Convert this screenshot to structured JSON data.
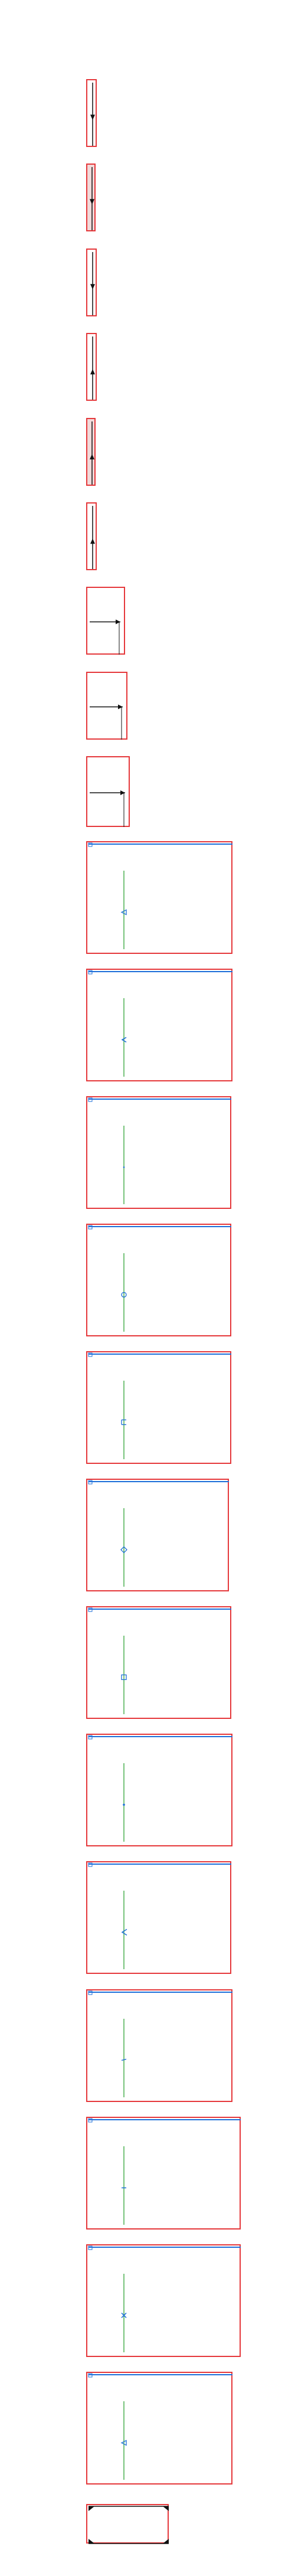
{
  "sheet": {
    "colors": {
      "frame": "#e5383b",
      "frame_fill_shaded": "#f1d9d9",
      "axis_line": "#4caf50",
      "marker": "#1e6fd9",
      "arrow": "#111111"
    },
    "cells": [
      {
        "id": "cell-1",
        "kind": "tall-arrow",
        "marker": "arrow-down-icon",
        "shaded": false
      },
      {
        "id": "cell-2",
        "kind": "tall-arrow",
        "marker": "arrow-down-icon",
        "shaded": true
      },
      {
        "id": "cell-3",
        "kind": "tall-arrow",
        "marker": "arrow-down-icon",
        "shaded": false
      },
      {
        "id": "cell-4",
        "kind": "tall-arrow",
        "marker": "arrow-up-icon",
        "shaded": false
      },
      {
        "id": "cell-5",
        "kind": "tall-arrow",
        "marker": "arrow-up-icon",
        "shaded": true
      },
      {
        "id": "cell-6",
        "kind": "tall-arrow",
        "marker": "arrow-up-icon",
        "shaded": false
      },
      {
        "id": "cell-7",
        "kind": "horizontal-arrow",
        "marker": "arrow-right-icon",
        "shaded": false
      },
      {
        "id": "cell-8",
        "kind": "horizontal-arrow",
        "marker": "arrow-right-icon",
        "shaded": false
      },
      {
        "id": "cell-9",
        "kind": "horizontal-arrow",
        "marker": "arrow-right-icon",
        "shaded": false
      },
      {
        "id": "cell-10",
        "kind": "marker-panel",
        "marker": "triangle-outline-icon"
      },
      {
        "id": "cell-11",
        "kind": "marker-panel",
        "marker": "caret-up-icon"
      },
      {
        "id": "cell-12",
        "kind": "marker-panel",
        "marker": "dot-icon"
      },
      {
        "id": "cell-13",
        "kind": "marker-panel",
        "marker": "circle-outline-icon"
      },
      {
        "id": "cell-14",
        "kind": "marker-panel",
        "marker": "bracket-icon"
      },
      {
        "id": "cell-15",
        "kind": "marker-panel",
        "marker": "diamond-outline-icon"
      },
      {
        "id": "cell-16",
        "kind": "marker-panel",
        "marker": "square-outline-icon"
      },
      {
        "id": "cell-17",
        "kind": "marker-panel",
        "marker": "small-dot-icon"
      },
      {
        "id": "cell-18",
        "kind": "marker-panel",
        "marker": "chevron-left-icon"
      },
      {
        "id": "cell-19",
        "kind": "marker-panel",
        "marker": "tick-left-icon"
      },
      {
        "id": "cell-20",
        "kind": "marker-panel",
        "marker": "tick-icon"
      },
      {
        "id": "cell-21",
        "kind": "marker-panel",
        "marker": "cross-icon"
      },
      {
        "id": "cell-22",
        "kind": "marker-panel",
        "marker": "triangle-outline-icon"
      },
      {
        "id": "cell-23",
        "kind": "bracket-box",
        "marker": "corner-triangles-icon"
      }
    ]
  }
}
